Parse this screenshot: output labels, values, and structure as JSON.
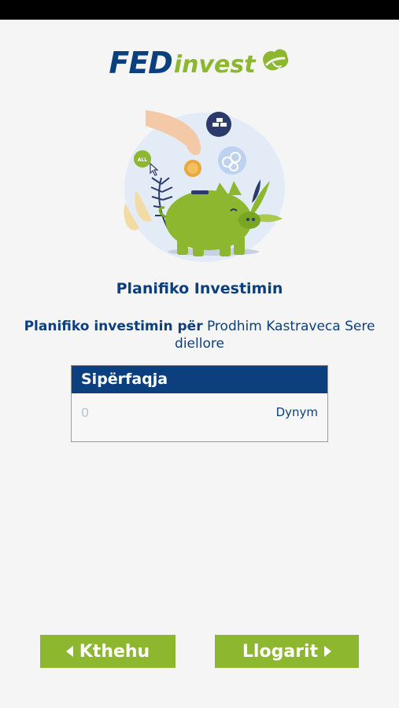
{
  "brand": {
    "logo_primary": "FED",
    "logo_secondary": "invest",
    "primary_color": "#0b3f7e",
    "accent_color": "#8cb72f"
  },
  "illustration": {
    "icon": "piggy-bank-coin-illustration",
    "badge_text": "ALL"
  },
  "page": {
    "title": "Planifiko Investimin",
    "subtitle_prefix": "Planifiko investimin për",
    "subtitle_subject": "Prodhim Kastraveca Sere diellore"
  },
  "form": {
    "field_label": "Sipërfaqja",
    "field_placeholder": "0",
    "field_value": "",
    "unit": "Dynym"
  },
  "actions": {
    "back_label": "Kthehu",
    "calculate_label": "Llogarit"
  }
}
